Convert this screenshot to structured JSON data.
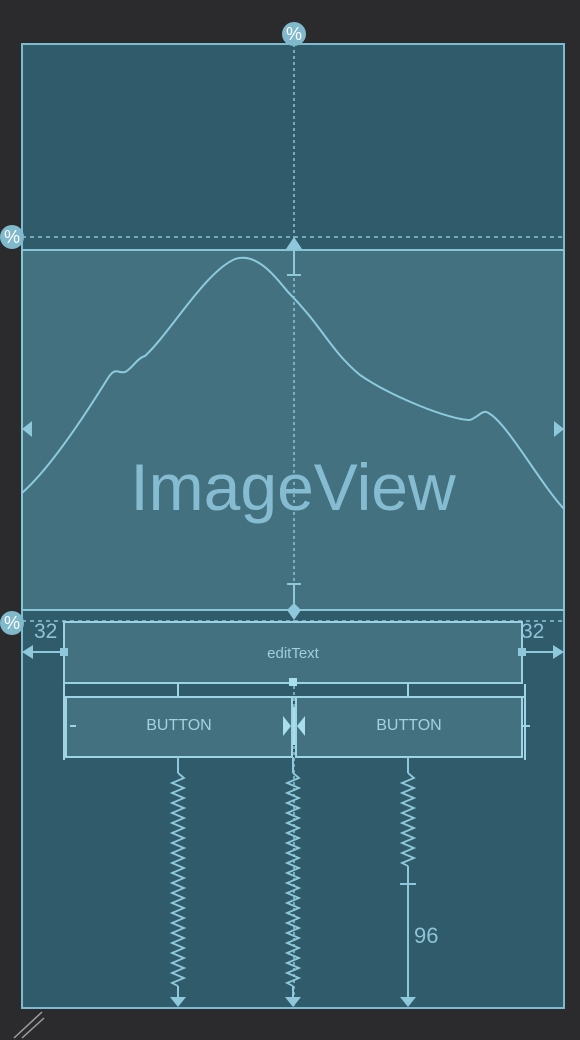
{
  "image_view": {
    "label": "ImageView"
  },
  "edit_text": {
    "label": "editText"
  },
  "buttons": [
    {
      "label": "BUTTON"
    },
    {
      "label": "BUTTON"
    }
  ],
  "constraints": {
    "left_margin": "32",
    "right_margin": "32",
    "bottom_margin": "96"
  },
  "icons": {
    "guideline_percent": "percent-icon",
    "left_arrow": "arrow-left-icon",
    "right_arrow": "arrow-right-icon",
    "chain": "chain-icon",
    "spring": "spring-icon"
  },
  "colors": {
    "canvas_background": "#2b2b2d",
    "layout_background": "#2f5b6b",
    "image_background": "#44717f",
    "blueprint_line": "#88c4d7",
    "blueprint_text": "#86bcd1"
  }
}
